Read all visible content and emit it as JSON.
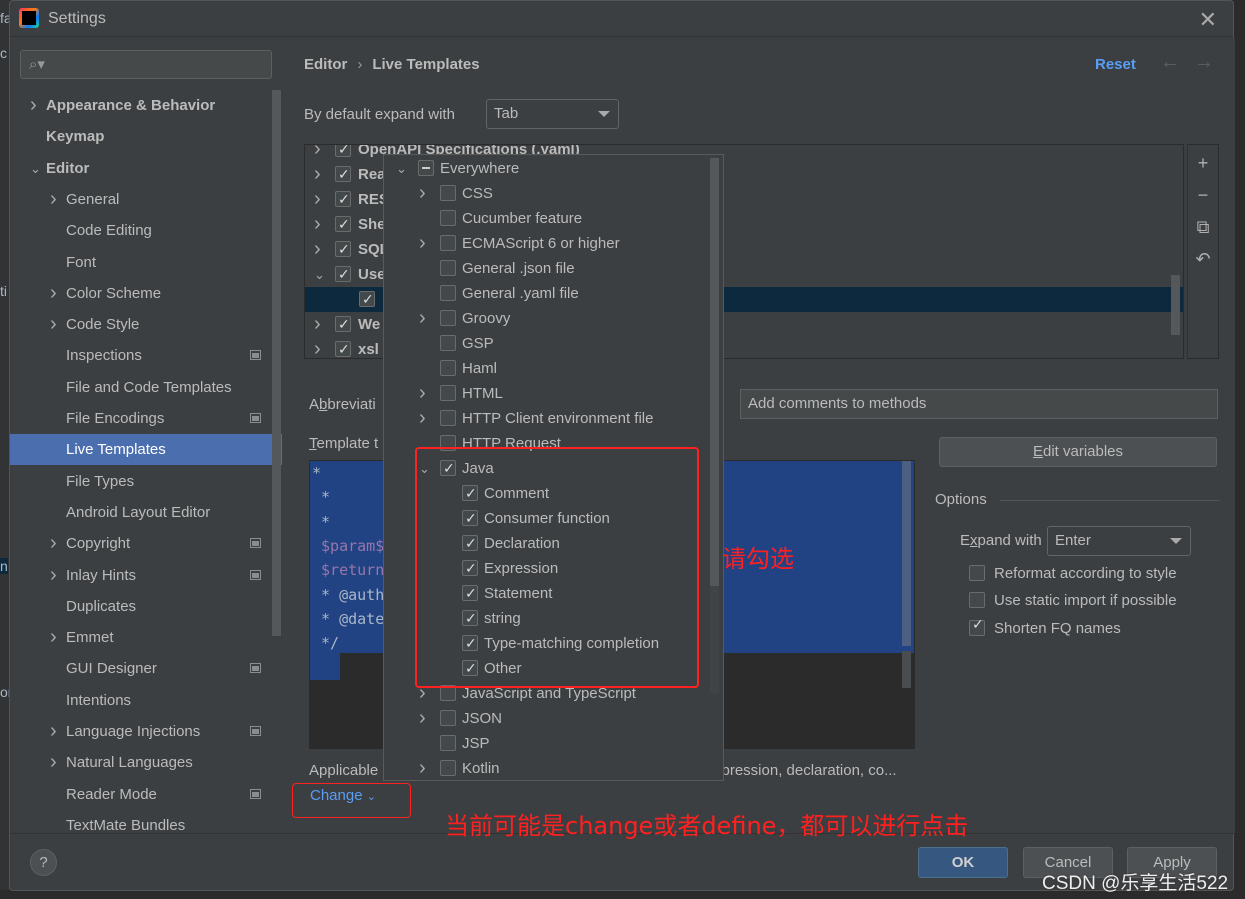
{
  "window": {
    "title": "Settings",
    "close_icon": "close-icon"
  },
  "background_fragments": [
    "fa",
    "c",
    "ti",
    "n",
    "on"
  ],
  "sidebar": {
    "search_placeholder": "",
    "items": [
      {
        "label": "Appearance & Behavior",
        "level": 0,
        "expandable": true,
        "expanded": false,
        "bold": true
      },
      {
        "label": "Keymap",
        "level": 0,
        "expandable": false,
        "bold": true
      },
      {
        "label": "Editor",
        "level": 0,
        "expandable": true,
        "expanded": true,
        "bold": true
      },
      {
        "label": "General",
        "level": 1,
        "expandable": true
      },
      {
        "label": "Code Editing",
        "level": 1
      },
      {
        "label": "Font",
        "level": 1
      },
      {
        "label": "Color Scheme",
        "level": 1,
        "expandable": true
      },
      {
        "label": "Code Style",
        "level": 1,
        "expandable": true
      },
      {
        "label": "Inspections",
        "level": 1,
        "project": true
      },
      {
        "label": "File and Code Templates",
        "level": 1
      },
      {
        "label": "File Encodings",
        "level": 1,
        "project": true
      },
      {
        "label": "Live Templates",
        "level": 1,
        "selected": true
      },
      {
        "label": "File Types",
        "level": 1
      },
      {
        "label": "Android Layout Editor",
        "level": 1
      },
      {
        "label": "Copyright",
        "level": 1,
        "expandable": true,
        "project": true
      },
      {
        "label": "Inlay Hints",
        "level": 1,
        "expandable": true,
        "project": true
      },
      {
        "label": "Duplicates",
        "level": 1
      },
      {
        "label": "Emmet",
        "level": 1,
        "expandable": true
      },
      {
        "label": "GUI Designer",
        "level": 1,
        "project": true
      },
      {
        "label": "Intentions",
        "level": 1
      },
      {
        "label": "Language Injections",
        "level": 1,
        "expandable": true,
        "project": true
      },
      {
        "label": "Natural Languages",
        "level": 1,
        "expandable": true
      },
      {
        "label": "Reader Mode",
        "level": 1,
        "project": true
      },
      {
        "label": "TextMate Bundles",
        "level": 1
      }
    ]
  },
  "header": {
    "breadcrumb": [
      "Editor",
      "Live Templates"
    ],
    "breadcrumb_sep": "›",
    "reset_label": "Reset",
    "back_icon": "←",
    "forward_icon": "→"
  },
  "expand_default": {
    "label": "By default expand with",
    "value": "Tab"
  },
  "template_groups": [
    {
      "label": "OpenAPI Specifications (.yaml)",
      "checked": true,
      "expanded": false
    },
    {
      "label": "Rea",
      "checked": true,
      "expanded": false
    },
    {
      "label": "RES",
      "checked": true,
      "expanded": false
    },
    {
      "label": "She",
      "checked": true,
      "expanded": false
    },
    {
      "label": "SQL",
      "checked": true,
      "expanded": false
    },
    {
      "label": "Use",
      "checked": true,
      "expanded": true
    },
    {
      "label": "*",
      "checked": true,
      "child": true,
      "selected": true
    },
    {
      "label": "We",
      "checked": true,
      "expanded": false
    },
    {
      "label": "xsl",
      "checked": true,
      "expanded": false
    }
  ],
  "toolbar": {
    "add": "+",
    "remove": "−",
    "copy": "⧉",
    "restore": "↶"
  },
  "abbreviation": {
    "label": "Abbreviati",
    "underline_char": "b"
  },
  "description": {
    "value": "Add comments to methods"
  },
  "template_text": {
    "label": "Template t",
    "lines": [
      "*",
      " *",
      " *",
      " $param$",
      " $return",
      " * @auth",
      " * @date",
      " */"
    ]
  },
  "edit_variables_label": "Edit variables",
  "options": {
    "title": "Options",
    "expand_with_label": "Expand with",
    "expand_with_value": "Enter",
    "checkboxes": [
      {
        "label": "Reformat according to style",
        "checked": false
      },
      {
        "label": "Use static import if possible",
        "checked": false
      },
      {
        "label": "Shorten FQ names",
        "checked": true
      }
    ]
  },
  "applicable": {
    "label": "Applicable",
    "tail": "xpression, declaration, co..."
  },
  "change_link": {
    "label": "Change",
    "icon": "⌄"
  },
  "context_popup": {
    "items": [
      {
        "label": "Everywhere",
        "level": 0,
        "expandable": true,
        "expanded": true,
        "state": "partial"
      },
      {
        "label": "CSS",
        "level": 1,
        "expandable": true,
        "state": "unchecked"
      },
      {
        "label": "Cucumber feature",
        "level": 1,
        "state": "unchecked"
      },
      {
        "label": "ECMAScript 6 or higher",
        "level": 1,
        "expandable": true,
        "state": "unchecked"
      },
      {
        "label": "General .json file",
        "level": 1,
        "state": "unchecked"
      },
      {
        "label": "General .yaml file",
        "level": 1,
        "state": "unchecked"
      },
      {
        "label": "Groovy",
        "level": 1,
        "expandable": true,
        "state": "unchecked"
      },
      {
        "label": "GSP",
        "level": 1,
        "state": "unchecked"
      },
      {
        "label": "Haml",
        "level": 1,
        "state": "unchecked"
      },
      {
        "label": "HTML",
        "level": 1,
        "expandable": true,
        "state": "unchecked"
      },
      {
        "label": "HTTP Client environment file",
        "level": 1,
        "expandable": true,
        "state": "unchecked"
      },
      {
        "label": "HTTP Request",
        "level": 1,
        "state": "unchecked"
      },
      {
        "label": "Java",
        "level": 1,
        "expandable": true,
        "expanded": true,
        "state": "checked"
      },
      {
        "label": "Comment",
        "level": 2,
        "state": "checked"
      },
      {
        "label": "Consumer function",
        "level": 2,
        "state": "checked"
      },
      {
        "label": "Declaration",
        "level": 2,
        "state": "checked"
      },
      {
        "label": "Expression",
        "level": 2,
        "state": "checked"
      },
      {
        "label": "Statement",
        "level": 2,
        "state": "checked"
      },
      {
        "label": "string",
        "level": 2,
        "state": "checked"
      },
      {
        "label": "Type-matching completion",
        "level": 2,
        "state": "checked"
      },
      {
        "label": "Other",
        "level": 2,
        "state": "checked"
      },
      {
        "label": "JavaScript and TypeScript",
        "level": 1,
        "expandable": true,
        "state": "unchecked"
      },
      {
        "label": "JSON",
        "level": 1,
        "expandable": true,
        "state": "unchecked"
      },
      {
        "label": "JSP",
        "level": 1,
        "state": "unchecked"
      },
      {
        "label": "Kotlin",
        "level": 1,
        "expandable": true,
        "state": "unchecked"
      }
    ]
  },
  "footer": {
    "help": "?",
    "ok": "OK",
    "cancel": "Cancel",
    "apply": "Apply"
  },
  "annotations": {
    "please_check": "请勾选",
    "change_note": "当前可能是change或者define，都可以进行点击",
    "color": "#ff2020"
  },
  "watermark": "CSDN @乐享生活522"
}
